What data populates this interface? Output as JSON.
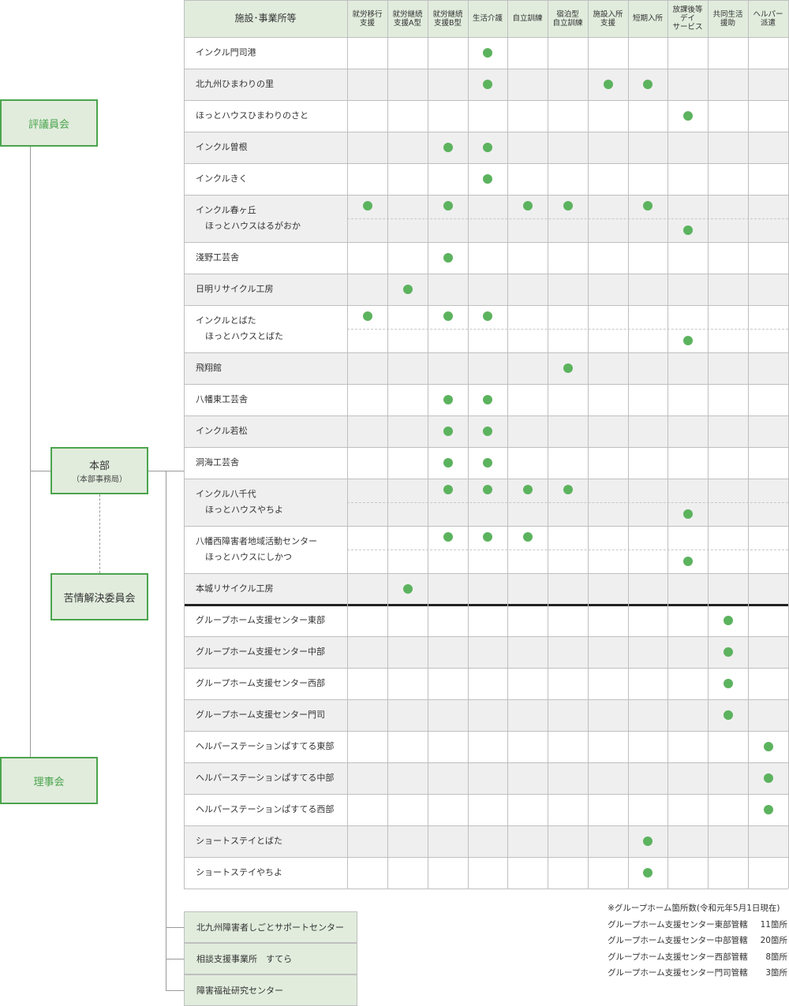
{
  "colors": {
    "accent": "#4ba44d",
    "dot": "#5cb35e",
    "header_bg": "#e1ecdd",
    "alt_row_bg": "#efefef"
  },
  "org": {
    "hyogiinkai": "評議員会",
    "honbu": "本部",
    "honbu_sub": "（本部事務局）",
    "kujo": "苦情解決委員会",
    "rijikai": "理事会"
  },
  "table": {
    "corner": "施設･事業所等",
    "columns": [
      "就労移行\n支援",
      "就労継続\n支援A型",
      "就労継続\n支援B型",
      "生活介護",
      "自立訓練",
      "宿泊型\n自立訓練",
      "施設入所\n支援",
      "短期入所",
      "放課後等\nデイ\nサービス",
      "共同生活\n援助",
      "ヘルパー\n派遣"
    ],
    "rows": [
      {
        "names": [
          "インクル門司港"
        ],
        "marks": [
          [],
          [
            "生活介護"
          ]
        ]
      },
      {
        "names": [
          "北九州ひまわりの里"
        ],
        "marks": [
          [],
          [
            "生活介護",
            "施設入所支援",
            "短期入所"
          ]
        ]
      },
      {
        "names": [
          "ほっとハウスひまわりのさと"
        ],
        "marks": [
          [],
          [
            "放課後等デイサービス"
          ]
        ]
      },
      {
        "names": [
          "インクル曽根"
        ],
        "marks": [
          [],
          [
            "就労継続支援B型",
            "生活介護"
          ]
        ]
      },
      {
        "names": [
          "インクルきく"
        ],
        "marks": [
          [],
          [
            "生活介護"
          ]
        ]
      },
      {
        "names": [
          "インクル春ヶ丘",
          "ほっとハウスはるがおか"
        ],
        "marks": [
          [
            "就労移行支援",
            "就労継続支援B型",
            "自立訓練",
            "宿泊型自立訓練",
            "短期入所"
          ],
          [
            "放課後等デイサービス"
          ]
        ]
      },
      {
        "names": [
          "淺野工芸舎"
        ],
        "marks": [
          [],
          [
            "就労継続支援B型"
          ]
        ]
      },
      {
        "names": [
          "日明リサイクル工房"
        ],
        "marks": [
          [],
          [
            "就労継続支援A型"
          ]
        ]
      },
      {
        "names": [
          "インクルとばた",
          "ほっとハウスとばた"
        ],
        "marks": [
          [
            "就労移行支援",
            "就労継続支援B型",
            "生活介護"
          ],
          [
            "放課後等デイサービス"
          ]
        ]
      },
      {
        "names": [
          "飛翔館"
        ],
        "marks": [
          [],
          [
            "宿泊型自立訓練"
          ]
        ]
      },
      {
        "names": [
          "八幡東工芸舎"
        ],
        "marks": [
          [],
          [
            "就労継続支援B型",
            "生活介護"
          ]
        ]
      },
      {
        "names": [
          "インクル若松"
        ],
        "marks": [
          [],
          [
            "就労継続支援B型",
            "生活介護"
          ]
        ]
      },
      {
        "names": [
          "洞海工芸舎"
        ],
        "marks": [
          [],
          [
            "就労継続支援B型",
            "生活介護"
          ]
        ]
      },
      {
        "names": [
          "インクル八千代",
          "ほっとハウスやちよ"
        ],
        "marks": [
          [
            "就労継続支援B型",
            "生活介護",
            "自立訓練",
            "宿泊型自立訓練"
          ],
          [
            "放課後等デイサービス"
          ]
        ]
      },
      {
        "names": [
          "八幡西障害者地域活動センター",
          "ほっとハウスにしかつ"
        ],
        "marks": [
          [
            "就労継続支援B型",
            "生活介護",
            "自立訓練"
          ],
          [
            "放課後等デイサービス"
          ]
        ]
      },
      {
        "names": [
          "本城リサイクル工房"
        ],
        "marks": [
          [],
          [
            "就労継続支援A型"
          ]
        ]
      },
      {
        "names": [
          "グループホーム支援センター東部"
        ],
        "marks": [
          [],
          [
            "共同生活援助"
          ]
        ]
      },
      {
        "names": [
          "グループホーム支援センター中部"
        ],
        "marks": [
          [],
          [
            "共同生活援助"
          ]
        ]
      },
      {
        "names": [
          "グループホーム支援センター西部"
        ],
        "marks": [
          [],
          [
            "共同生活援助"
          ]
        ]
      },
      {
        "names": [
          "グループホーム支援センター門司"
        ],
        "marks": [
          [],
          [
            "共同生活援助"
          ]
        ]
      },
      {
        "names": [
          "ヘルパーステーションぱすてる東部"
        ],
        "marks": [
          [],
          [
            "ヘルパー派遣"
          ]
        ]
      },
      {
        "names": [
          "ヘルパーステーションぱすてる中部"
        ],
        "marks": [
          [],
          [
            "ヘルパー派遣"
          ]
        ]
      },
      {
        "names": [
          "ヘルパーステーションぱすてる西部"
        ],
        "marks": [
          [],
          [
            "ヘルパー派遣"
          ]
        ]
      },
      {
        "names": [
          "ショートステイとばた"
        ],
        "marks": [
          [],
          [
            "短期入所"
          ]
        ]
      },
      {
        "names": [
          "ショートステイやちよ"
        ],
        "marks": [
          [],
          [
            "短期入所"
          ]
        ]
      }
    ]
  },
  "bottom_boxes": [
    "北九州障害者しごとサポートセンター",
    "相談支援事業所　すてら",
    "障害福祉研究センター"
  ],
  "notes": {
    "heading": "※グループホーム箇所数(令和元年5月1日現在)",
    "items": [
      {
        "label": "グループホーム支援センター東部管轄",
        "count": "11箇所"
      },
      {
        "label": "グループホーム支援センター中部管轄",
        "count": "20箇所"
      },
      {
        "label": "グループホーム支援センター西部管轄",
        "count": "8箇所"
      },
      {
        "label": "グループホーム支援センター門司管轄",
        "count": "3箇所"
      }
    ]
  }
}
